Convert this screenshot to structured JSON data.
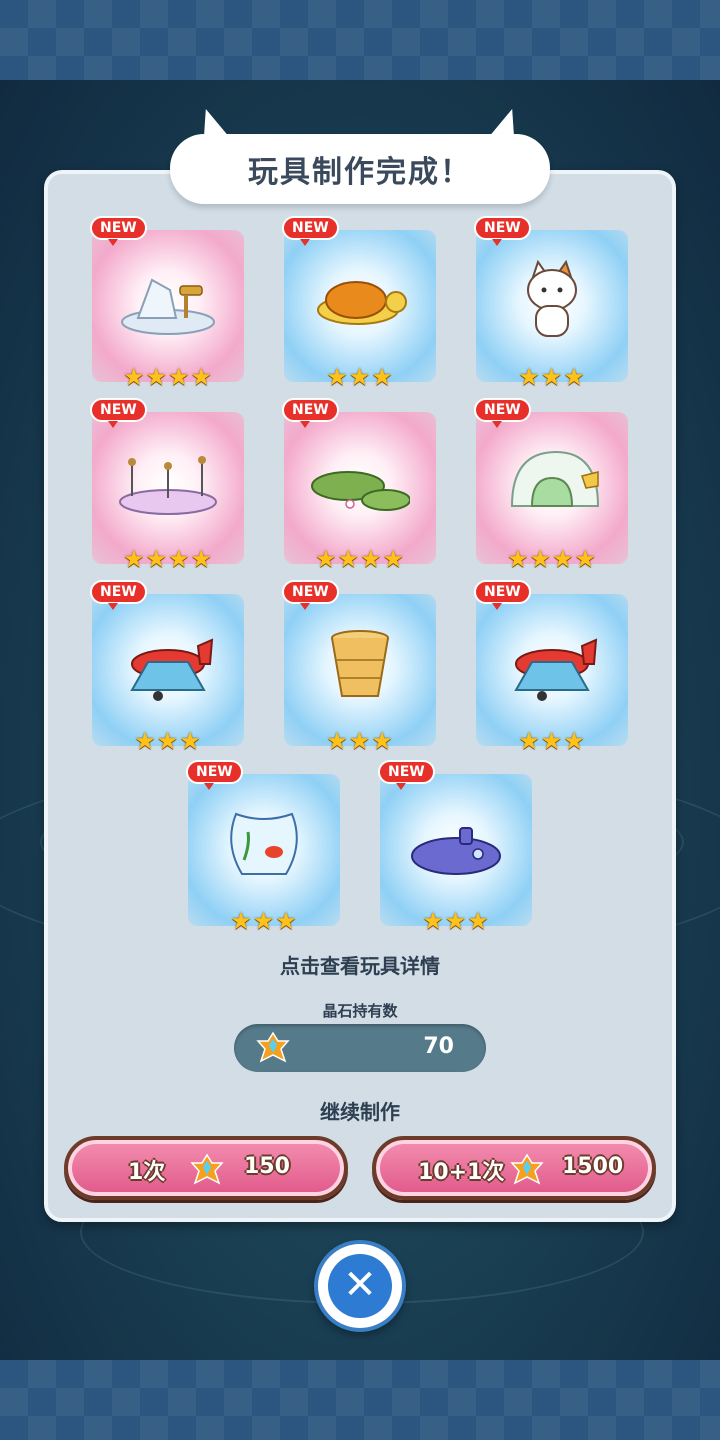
{
  "dialog": {
    "title": "玩具制作完成！",
    "new_label": "NEW",
    "toys": [
      {
        "name": "iceberg-telescope",
        "stars": "★★★★",
        "glow": "pink"
      },
      {
        "name": "turtle",
        "stars": "★★★",
        "glow": "blue"
      },
      {
        "name": "calico-cat",
        "stars": "★★★",
        "glow": "blue"
      },
      {
        "name": "stage",
        "stars": "★★★★",
        "glow": "pink"
      },
      {
        "name": "lily-pads",
        "stars": "★★★★",
        "glow": "pink"
      },
      {
        "name": "igloo",
        "stars": "★★★★",
        "glow": "pink"
      },
      {
        "name": "airplane",
        "stars": "★★★",
        "glow": "blue"
      },
      {
        "name": "basket",
        "stars": "★★★",
        "glow": "blue"
      },
      {
        "name": "airplane",
        "stars": "★★★",
        "glow": "blue"
      },
      {
        "name": "fishbowl",
        "stars": "★★★",
        "glow": "blue"
      },
      {
        "name": "whale-submarine",
        "stars": "★★★",
        "glow": "blue"
      }
    ],
    "hint": "点击查看玩具详情",
    "crystal_label": "晶石持有数",
    "crystal_count": "70",
    "continue_label": "继续制作",
    "buttons": {
      "single": {
        "label": "1次",
        "cost": "150"
      },
      "multi": {
        "label": "10+1次",
        "cost": "1500"
      }
    }
  },
  "colors": {
    "accent_pink": "#e0588a",
    "close_blue": "#2d7bd2"
  }
}
